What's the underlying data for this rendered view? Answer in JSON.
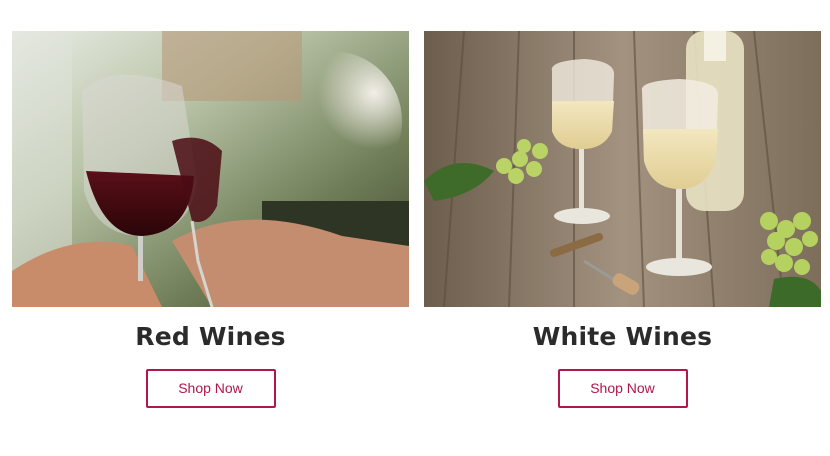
{
  "categories": [
    {
      "title": "Red Wines",
      "button_label": "Shop Now",
      "image": "red-wine-toast-photo"
    },
    {
      "title": "White Wines",
      "button_label": "Shop Now",
      "image": "white-wine-table-photo"
    }
  ],
  "colors": {
    "accent": "#b0174a",
    "title": "#2b2b2b"
  }
}
